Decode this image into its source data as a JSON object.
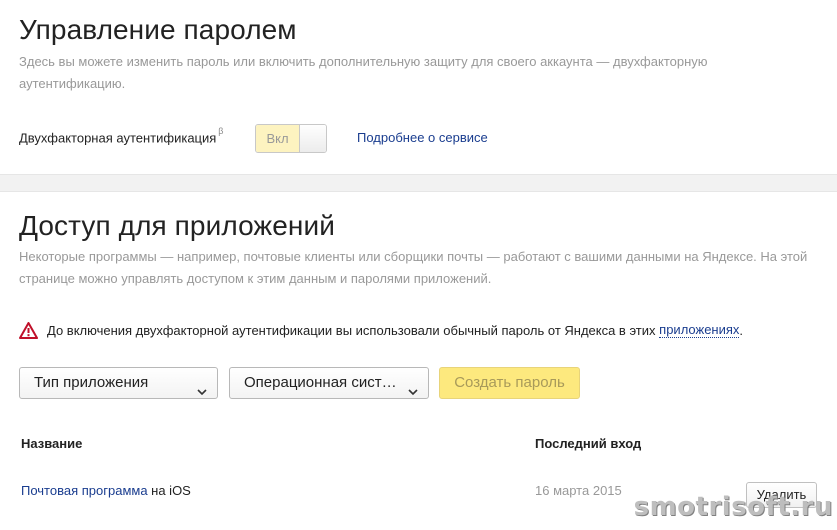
{
  "password_section": {
    "title": "Управление паролем",
    "description": "Здесь вы можете изменить пароль или включить дополнительную защиту для своего аккаунта — двухфакторную аутентификацию.",
    "two_factor_label": "Двухфакторная аутентификация",
    "beta_mark": "β",
    "toggle_label": "Вкл",
    "more_link": "Подробнее о сервисе"
  },
  "apps_section": {
    "title": "Доступ для приложений",
    "description": "Некоторые программы — например, почтовые клиенты или сборщики почты — работают с вашими данными на Яндексе. На этой странице можно управлять доступом к этим данным и паролями приложений.",
    "warning_text": "До включения двухфакторной аутентификации вы использовали обычный пароль от Яндекса в этих",
    "warning_link": "приложениях",
    "warning_end": ".",
    "app_type_select": "Тип приложения",
    "os_select": "Операционная сист…",
    "create_button": "Создать пароль",
    "table": {
      "columns": [
        "Название",
        "Последний вход"
      ],
      "rows": [
        {
          "name_link": "Почтовая программа",
          "name_suffix": " на iOS",
          "last_login": "16 марта 2015",
          "delete_label": "Удалить"
        }
      ]
    }
  },
  "watermark": "smotrisoft.ru",
  "colors": {
    "link": "#1a3d8f",
    "toggle_on": "#fdf3c0",
    "create_button": "#fde97e",
    "warning_icon": "#c0102a"
  }
}
